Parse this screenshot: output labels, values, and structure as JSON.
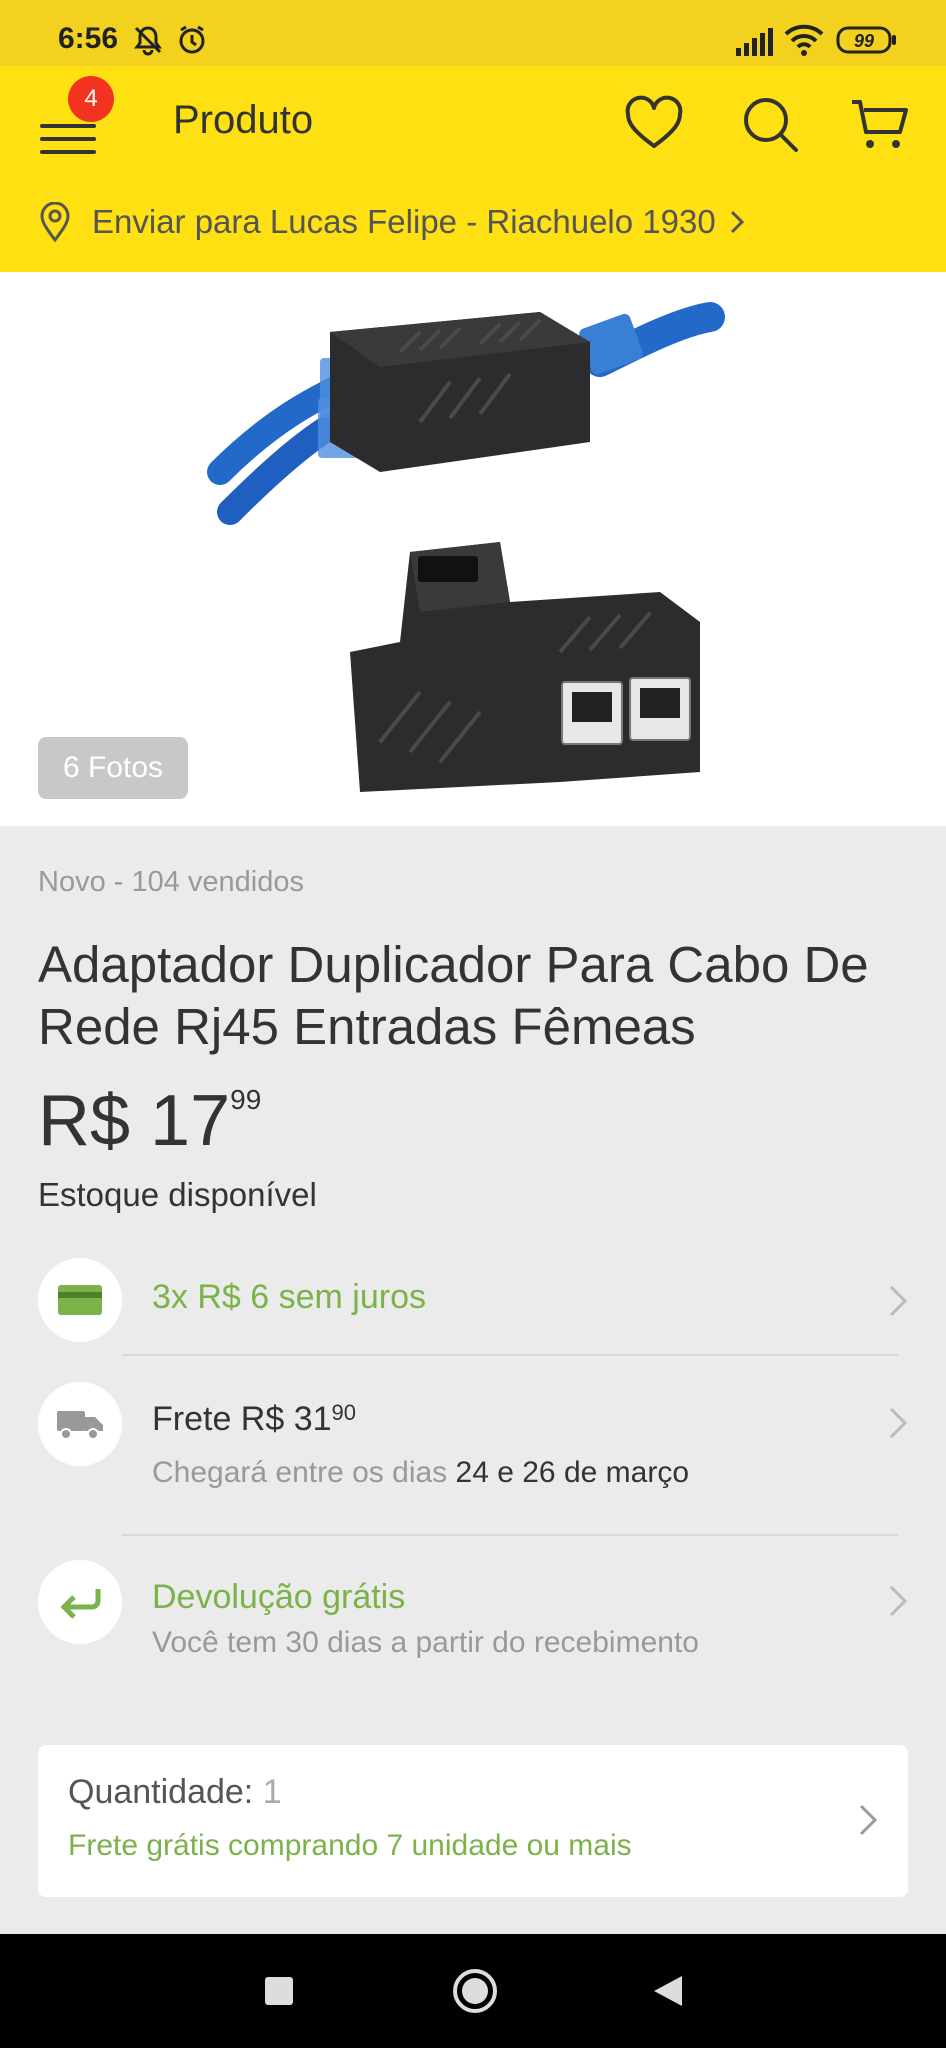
{
  "status_bar": {
    "time": "6:56",
    "battery": "99"
  },
  "app_bar": {
    "notification_count": "4",
    "title": "Produto",
    "shipping_text": "Enviar para Lucas Felipe - Riachuelo 1930"
  },
  "gallery": {
    "photo_count": "6 Fotos"
  },
  "product": {
    "condition": "Novo - 104 vendidos",
    "title": "Adaptador Duplicador Para Cabo De Rede Rj45 Entradas Fêmeas",
    "price_main": "R$ 17",
    "price_cents": "99",
    "stock": "Estoque disponível"
  },
  "installments": {
    "text": "3x R$ 6 sem juros"
  },
  "shipping": {
    "label": "Frete R$ 31",
    "cents": "90",
    "eta_prefix": "Chegará entre os dias ",
    "eta_dates": "24 e 26 de março"
  },
  "returns": {
    "title": "Devolução grátis",
    "subtitle": "Você tem 30 dias a partir do recebimento"
  },
  "quantity": {
    "label": "Quantidade: ",
    "value": "1",
    "promo": "Frete grátis comprando 7 unidade ou mais"
  },
  "colors": {
    "brand_yellow": "#ffe012",
    "green": "#7bb24a",
    "badge_red": "#f2331f"
  }
}
